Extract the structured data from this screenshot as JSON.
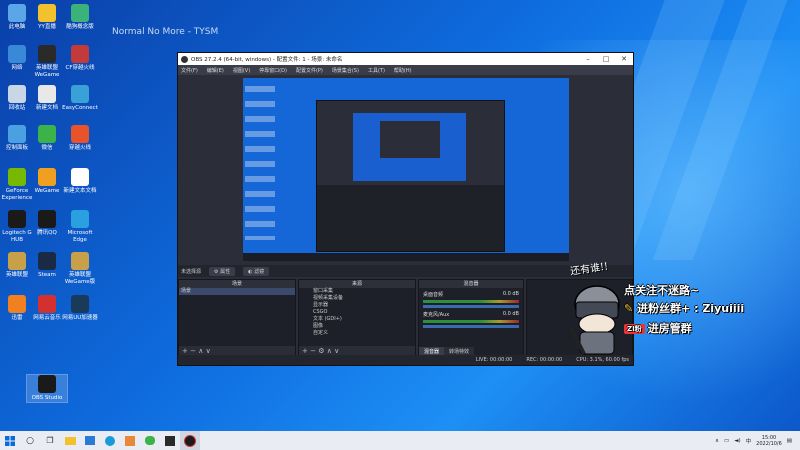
{
  "desktop": {
    "title_overlay": "Normal No More - TYSM",
    "icons": [
      {
        "label": "此电脑",
        "color": "#5aa6e6"
      },
      {
        "label": "YY直播",
        "color": "#f2c12e"
      },
      {
        "label": "酷狗概念版",
        "color": "#3bb27a"
      },
      {
        "label": "网络",
        "color": "#3a89d8"
      },
      {
        "label": "英雄联盟WeGame",
        "color": "#2a2a2a"
      },
      {
        "label": "CF穿越火线",
        "color": "#c33a3a"
      },
      {
        "label": "回收站",
        "color": "#c9d6e6"
      },
      {
        "label": "新建文档",
        "color": "#e8e8e8"
      },
      {
        "label": "EasyConnect",
        "color": "#3aa0d8"
      },
      {
        "label": "控制面板",
        "color": "#4aa0e0"
      },
      {
        "label": "微信",
        "color": "#3cb34a"
      },
      {
        "label": "穿越火线",
        "color": "#e8532b"
      },
      {
        "label": "GeForce Experience",
        "color": "#76b900"
      },
      {
        "label": "WeGame",
        "color": "#f0a020"
      },
      {
        "label": "新建文本文档",
        "color": "#ffffff"
      },
      {
        "label": "Logitech G HUB",
        "color": "#1a1a1a"
      },
      {
        "label": "腾讯QQ",
        "color": "#1a1a1a"
      },
      {
        "label": "Microsoft Edge",
        "color": "#2aa0e0"
      },
      {
        "label": "英雄联盟",
        "color": "#c8a04a"
      },
      {
        "label": "Steam",
        "color": "#1b2a44"
      },
      {
        "label": "英雄联盟WeGame版",
        "color": "#c8a04a"
      },
      {
        "label": "迅雷",
        "color": "#f08020"
      },
      {
        "label": "网易云音乐",
        "color": "#d33030"
      },
      {
        "label": "网易UU加速器",
        "color": "#1a3a5a"
      },
      {
        "label": "OBS Studio",
        "color": "#1a1a1a"
      }
    ]
  },
  "obs": {
    "window_title": "OBS 27.2.4 (64-bit, windows) - 配置文件: 1 - 场景: 未命名",
    "menu": [
      "文件(F)",
      "编辑(E)",
      "视图(V)",
      "停靠窗口(D)",
      "配置文件(P)",
      "场景集合(S)",
      "工具(T)",
      "帮助(H)"
    ],
    "source_label": "未选择源",
    "props_button": "属性",
    "filters_button": "滤镜",
    "scenes_title": "场景",
    "scenes": [
      "场景"
    ],
    "sources_title": "来源",
    "sources": [
      "窗口采集",
      "视频采集设备",
      "显示器",
      "CSGO",
      "文本 (GDI+)",
      "图像",
      "自定义"
    ],
    "mixer_title": "混音器",
    "mixer_tracks": [
      {
        "name": "桌面音频",
        "level": "0.0 dB"
      },
      {
        "name": "麦克风/Aux",
        "level": "0.0 dB"
      }
    ],
    "mixer_tabs": [
      "混音器",
      "转场特效"
    ],
    "status": [
      "LIVE: 00:00:00",
      "REC: 00:00:00",
      "CPU: 3.1%, 60.00 fps"
    ]
  },
  "overlay": {
    "speech": "还有谁!!",
    "lines": [
      "点关注不迷路~",
      "进粉丝群+ : Ziyuiiii",
      "进房管群"
    ],
    "badge": "ZI粉"
  },
  "taskbar": {
    "time": "15:00",
    "date": "2022/10/6"
  }
}
